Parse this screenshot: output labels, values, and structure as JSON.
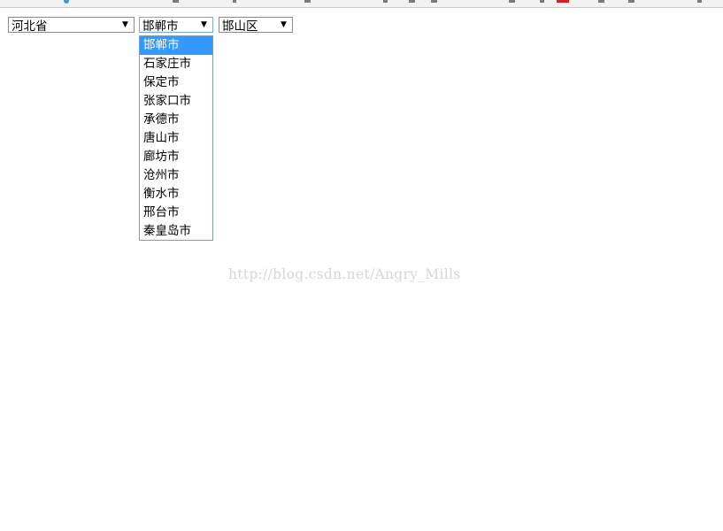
{
  "selects": {
    "province": {
      "value": "河北省",
      "arrow": "▼"
    },
    "city": {
      "value": "邯郸市",
      "arrow": "▼"
    },
    "district": {
      "value": "邯山区",
      "arrow": "▼"
    }
  },
  "city_options": [
    "邯郸市",
    "石家庄市",
    "保定市",
    "张家口市",
    "承德市",
    "唐山市",
    "廊坊市",
    "沧州市",
    "衡水市",
    "邢台市",
    "秦皇岛市"
  ],
  "watermark": "http://blog.csdn.net/Angry_Mills",
  "colors": {
    "option_highlight": "#3399ff",
    "watermark": "#d6d6d6"
  }
}
